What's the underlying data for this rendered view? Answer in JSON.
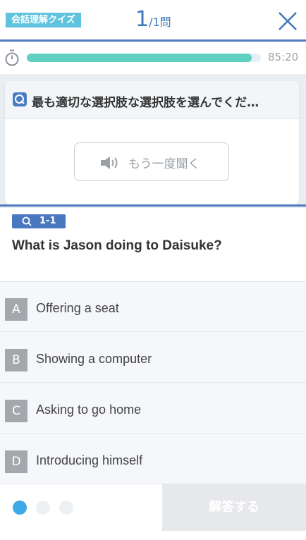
{
  "header": {
    "category_tag": "会話理解クイズ",
    "current_question": "1",
    "total_questions": "/1問",
    "close_icon": "close-icon"
  },
  "timer": {
    "icon": "stopwatch-icon",
    "progress_fraction": 0.96,
    "remaining_time": "85:20",
    "progress_color": "#5fd0c2"
  },
  "question_card": {
    "icon": "question-icon",
    "instruction": "最も適切な選択肢な選択肢を選んでくだ…",
    "listen_again": {
      "icon": "speaker-icon",
      "label": "もう一度聞く"
    }
  },
  "question": {
    "badge_icon": "question-icon",
    "badge_label": "1-1",
    "text": "What is Jason doing to Daisuke?"
  },
  "options": [
    {
      "letter": "A",
      "text": "Offering a seat"
    },
    {
      "letter": "B",
      "text": "Showing a computer"
    },
    {
      "letter": "C",
      "text": "Asking to go home"
    },
    {
      "letter": "D",
      "text": "Introducing himself"
    }
  ],
  "footer": {
    "pagination_dots": 3,
    "active_dot": 1,
    "answer_button": "解答する"
  },
  "colors": {
    "accent_blue": "#4e7cc0",
    "tag_cyan": "#5fc3de",
    "active_dot": "#3fa8e6",
    "option_letter_bg": "#a4a8ad"
  }
}
